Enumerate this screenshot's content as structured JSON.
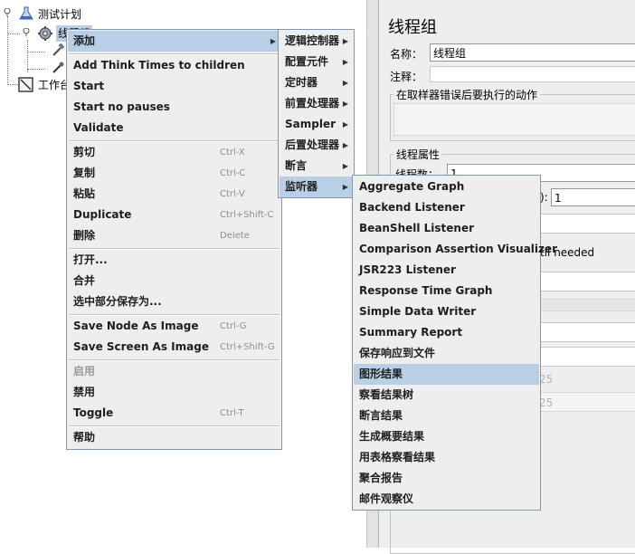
{
  "tree": {
    "root_label": "测试计划",
    "thread_group_label": "线程组",
    "workbench_label": "工作台"
  },
  "right_panel": {
    "title": "线程组",
    "name_label": "名称：",
    "name_value": "线程组",
    "comment_label": "注释：",
    "sampler_error_group": "在取样器错误后要执行的动作",
    "thread_props_group": "线程属性",
    "thread_count_label": "线程数：",
    "thread_count_value": "1",
    "ramp_up_label": "):",
    "ramp_up_value": "1",
    "delay_text": "til needed",
    "faint_1": "25",
    "faint_2": "25"
  },
  "context_menu": {
    "items": [
      {
        "label": "添加",
        "shortcut": "",
        "submenu": true
      },
      {
        "label": "Add Think Times to children",
        "shortcut": ""
      },
      {
        "label": "Start",
        "shortcut": ""
      },
      {
        "label": "Start no pauses",
        "shortcut": ""
      },
      {
        "label": "Validate",
        "shortcut": ""
      },
      {
        "label": "剪切",
        "shortcut": "Ctrl-X"
      },
      {
        "label": "复制",
        "shortcut": "Ctrl-C"
      },
      {
        "label": "粘贴",
        "shortcut": "Ctrl-V"
      },
      {
        "label": "Duplicate",
        "shortcut": "Ctrl+Shift-C"
      },
      {
        "label": "删除",
        "shortcut": "Delete"
      },
      {
        "label": "打开...",
        "shortcut": ""
      },
      {
        "label": "合并",
        "shortcut": ""
      },
      {
        "label": "选中部分保存为...",
        "shortcut": ""
      },
      {
        "label": "Save Node As Image",
        "shortcut": "Ctrl-G"
      },
      {
        "label": "Save Screen As Image",
        "shortcut": "Ctrl+Shift-G"
      },
      {
        "label": "启用",
        "shortcut": "",
        "disabled": true
      },
      {
        "label": "禁用",
        "shortcut": ""
      },
      {
        "label": "Toggle",
        "shortcut": "Ctrl-T"
      },
      {
        "label": "帮助",
        "shortcut": ""
      }
    ]
  },
  "add_submenu": {
    "items": [
      {
        "label": "逻辑控制器"
      },
      {
        "label": "配置元件"
      },
      {
        "label": "定时器"
      },
      {
        "label": "前置处理器"
      },
      {
        "label": "Sampler"
      },
      {
        "label": "后置处理器"
      },
      {
        "label": "断言"
      },
      {
        "label": "监听器"
      }
    ]
  },
  "listener_submenu": {
    "items": [
      {
        "label": "Aggregate Graph"
      },
      {
        "label": "Backend Listener"
      },
      {
        "label": "BeanShell Listener"
      },
      {
        "label": "Comparison Assertion Visualizer"
      },
      {
        "label": "JSR223 Listener"
      },
      {
        "label": "Response Time Graph"
      },
      {
        "label": "Simple Data Writer"
      },
      {
        "label": "Summary Report"
      },
      {
        "label": "保存响应到文件"
      },
      {
        "label": "图形结果"
      },
      {
        "label": "察看结果树"
      },
      {
        "label": "断言结果"
      },
      {
        "label": "生成概要结果"
      },
      {
        "label": "用表格察看结果"
      },
      {
        "label": "聚合报告"
      },
      {
        "label": "邮件观察仪"
      }
    ]
  },
  "colors": {
    "menu_bg": "#eeeeee",
    "menu_border": "#7f99b3",
    "selection": "#b8cfe5"
  }
}
